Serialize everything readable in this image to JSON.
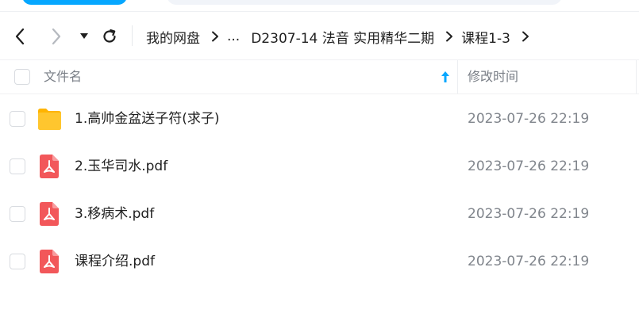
{
  "navbar": {
    "back_icon": "chevron-left-icon",
    "forward_icon": "chevron-right-icon",
    "history_icon": "caret-down-icon",
    "refresh_icon": "refresh-icon",
    "breadcrumb": [
      {
        "label": "我的网盘"
      },
      {
        "label": "..."
      },
      {
        "label": "D2307-14 法音 实用精华二期"
      },
      {
        "label": "课程1-3"
      }
    ]
  },
  "table": {
    "columns": {
      "name": "文件名",
      "modified": "修改时间"
    },
    "sort_icon": "arrow-up-icon",
    "rows": [
      {
        "name": "1.高帅金盆送子符(求子)",
        "modified": "2023-07-26 22:19",
        "type": "folder"
      },
      {
        "name": "2.玉华司水.pdf",
        "modified": "2023-07-26 22:19",
        "type": "pdf"
      },
      {
        "name": "3.移病术.pdf",
        "modified": "2023-07-26 22:19",
        "type": "pdf"
      },
      {
        "name": "课程介绍.pdf",
        "modified": "2023-07-26 22:19",
        "type": "pdf"
      }
    ]
  },
  "colors": {
    "accent": "#06a7ff",
    "folder": "#ffc62e",
    "pdf": "#f2575a",
    "sort_arrow": "#06a7ff"
  }
}
